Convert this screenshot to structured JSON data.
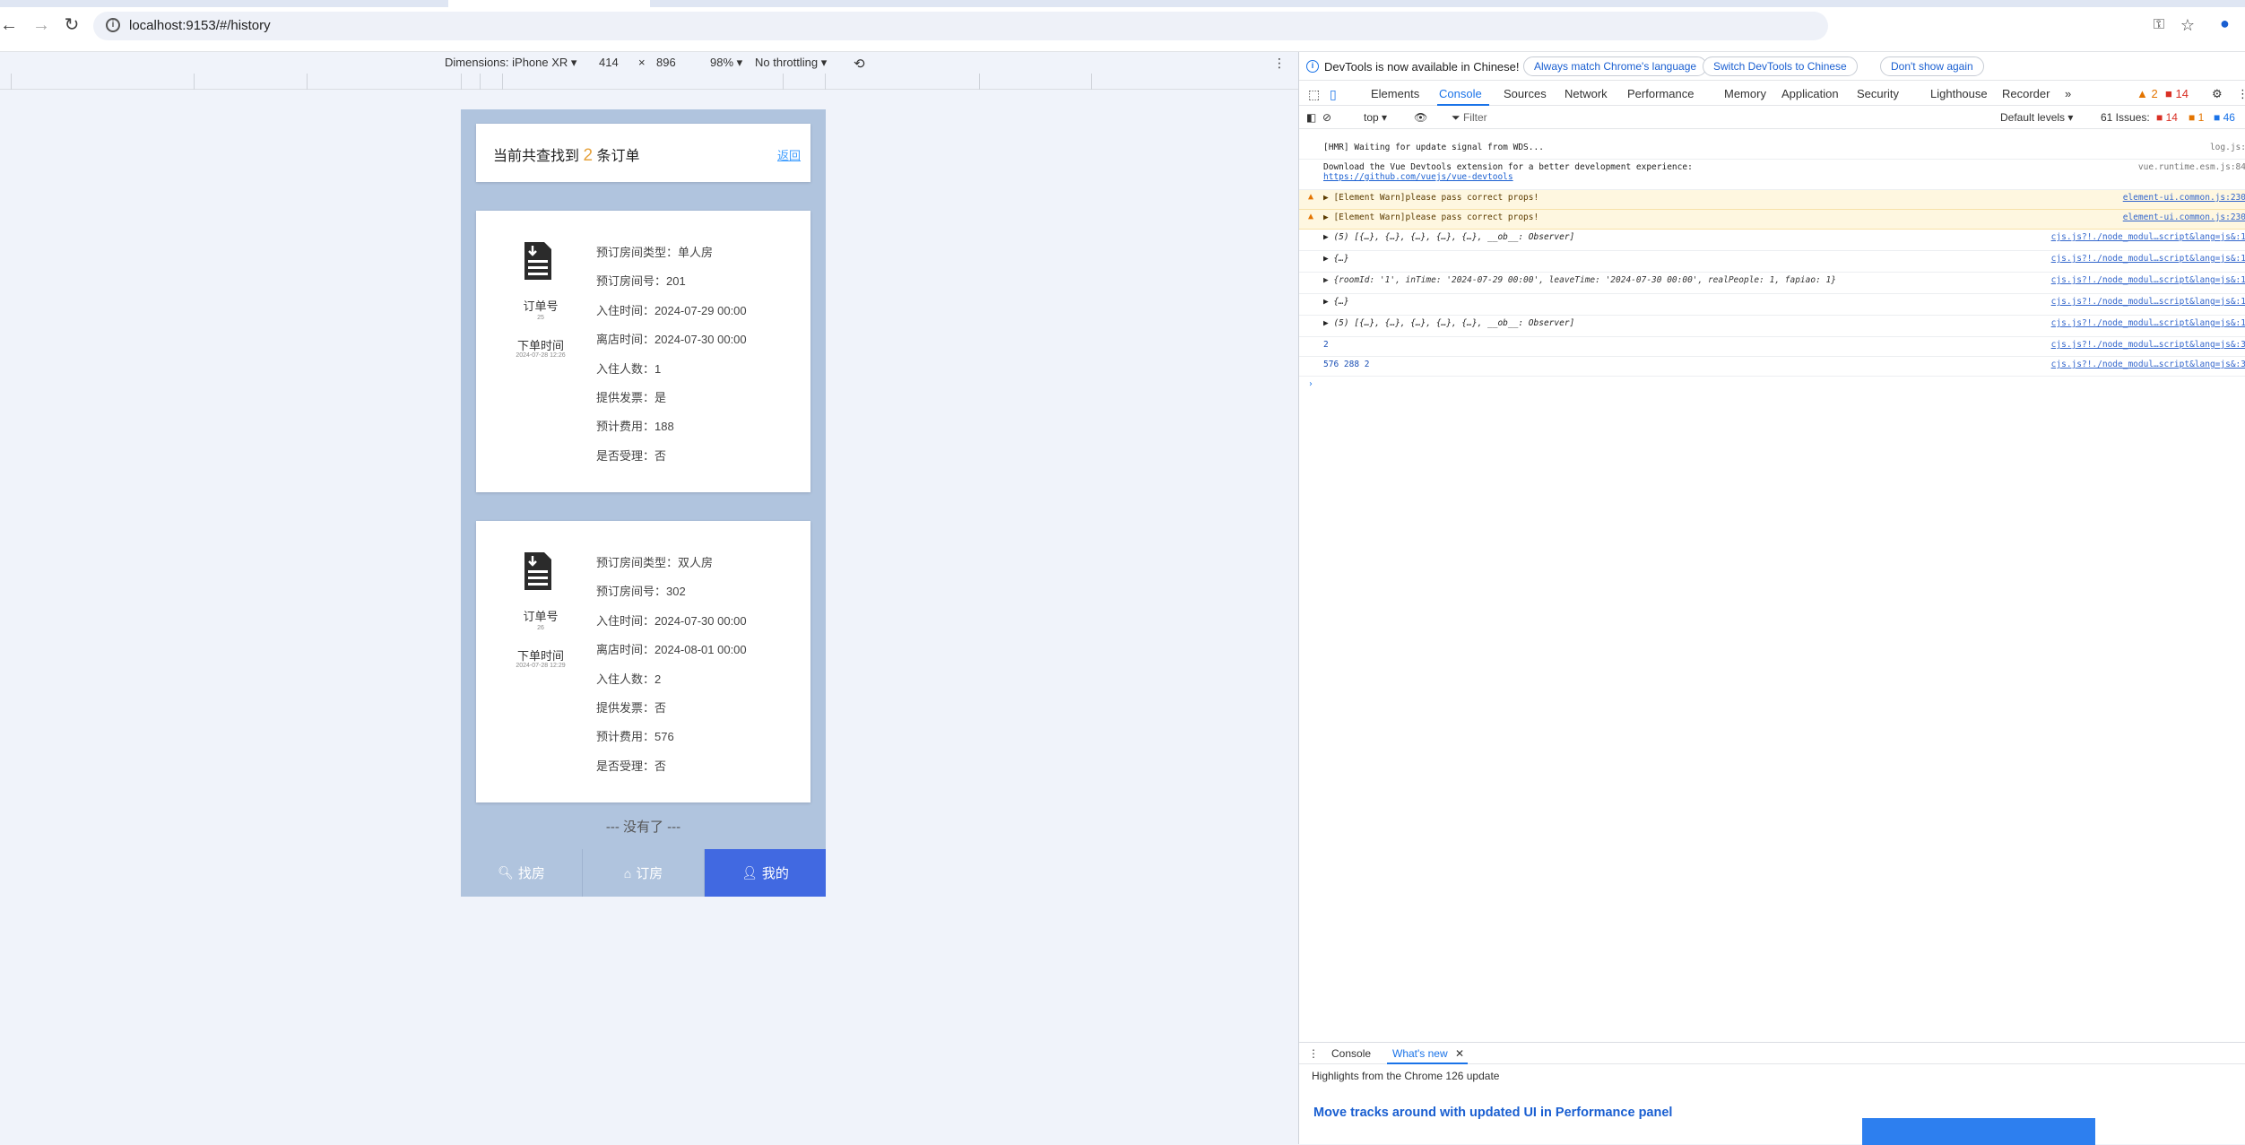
{
  "browser": {
    "url": "localhost:9153/#/history",
    "icons": [
      "back-icon",
      "forward-icon",
      "reload-icon",
      "info-icon",
      "key-icon",
      "star-icon",
      "profile-icon"
    ]
  },
  "device_toolbar": {
    "dimensions_label": "Dimensions: iPhone XR",
    "width": "414",
    "times": "×",
    "height": "896",
    "zoom": "98%",
    "throttling": "No throttling"
  },
  "app": {
    "summary_prefix": "当前共查找到",
    "summary_count": "2",
    "summary_suffix": "条订单",
    "back_link": "返回",
    "orders": [
      {
        "order_label": "订单号",
        "order_no": "25",
        "time_label": "下单时间",
        "order_time": "2024-07-28 12:26",
        "rows": [
          "预订房间类型：单人房",
          "预订房间号：201",
          "入住时间：2024-07-29 00:00",
          "离店时间：2024-07-30 00:00",
          "入住人数：1",
          "提供发票：是",
          "预计费用：188",
          "是否受理：否"
        ]
      },
      {
        "order_label": "订单号",
        "order_no": "26",
        "time_label": "下单时间",
        "order_time": "2024-07-28 12:29",
        "rows": [
          "预订房间类型：双人房",
          "预订房间号：302",
          "入住时间：2024-07-30 00:00",
          "离店时间：2024-08-01 00:00",
          "入住人数：2",
          "提供发票：否",
          "预计费用：576",
          "是否受理：否"
        ]
      }
    ],
    "no_more": "--- 没有了 ---",
    "tabs": [
      {
        "label": "找房",
        "icon": "search-icon"
      },
      {
        "label": "订房",
        "icon": "house-icon"
      },
      {
        "label": "我的",
        "icon": "user-icon"
      }
    ],
    "active_tab": "我的"
  },
  "devtools": {
    "notice": "DevTools is now available in Chinese!",
    "notice_buttons": [
      "Always match Chrome's language",
      "Switch DevTools to Chinese",
      "Don't show again"
    ],
    "panels": [
      "Elements",
      "Console",
      "Sources",
      "Network",
      "Performance",
      "Memory",
      "Application",
      "Security",
      "Lighthouse",
      "Recorder"
    ],
    "active_panel": "Console",
    "badges": {
      "warnings": "2",
      "errors": "14"
    },
    "badge_issues": [
      "14",
      "1",
      "46"
    ],
    "context": "top",
    "filter_placeholder": "Filter",
    "levels": "Default levels",
    "issues": "61 Issues:",
    "console": [
      {
        "text": "[HMR] Waiting for update signal from WDS...",
        "src": "log.js:"
      },
      {
        "text": "Download the Vue Devtools extension for a better development experience:",
        "link": "https://github.com/vuejs/vue-devtools",
        "src": "vue.runtime.esm.js:84"
      },
      {
        "text": "▶ [Element Warn]please pass correct props!",
        "src": "element-ui.common.js:230",
        "warn": true
      },
      {
        "text": "▶ [Element Warn]please pass correct props!",
        "src": "element-ui.common.js:230",
        "warn": true
      },
      {
        "text": "▶ (5) [{…}, {…}, {…}, {…}, {…}, __ob__: Observer]",
        "src": "cjs.js?!./node_modul…script&lang=js&:1"
      },
      {
        "text": "▶ {…}",
        "src": "cjs.js?!./node_modul…script&lang=js&:1"
      },
      {
        "text": "▶ {roomId: '1', inTime: '2024-07-29 00:00', leaveTime: '2024-07-30 00:00', realPeople: 1, fapiao: 1}",
        "src": "cjs.js?!./node_modul…script&lang=js&:1"
      },
      {
        "text": "▶ {…}",
        "src": "cjs.js?!./node_modul…script&lang=js&:1"
      },
      {
        "text": "▶ (5) [{…}, {…}, {…}, {…}, {…}, __ob__: Observer]",
        "src": "cjs.js?!./node_modul…script&lang=js&:1"
      },
      {
        "text": "2",
        "src": "cjs.js?!./node_modul…script&lang=js&:3"
      },
      {
        "text": "576 288 2",
        "src": "cjs.js?!./node_modul…script&lang=js&:3"
      }
    ],
    "drawer_tabs": [
      "Console",
      "What's new"
    ],
    "drawer_sub": "Highlights from the Chrome 126 update",
    "drawer_headline": "Move tracks around with updated UI in Performance panel"
  }
}
